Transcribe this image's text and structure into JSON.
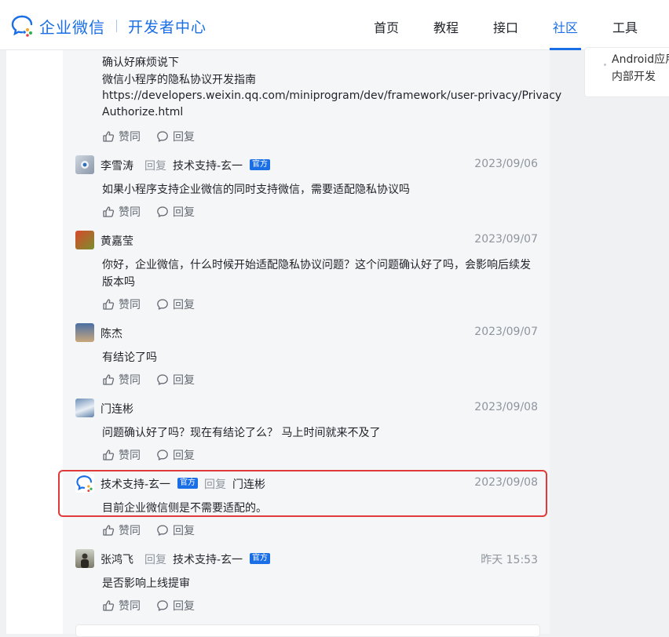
{
  "header": {
    "brand": "企业微信",
    "subtitle": "开发者中心",
    "nav": [
      "首页",
      "教程",
      "接口",
      "社区",
      "工具"
    ],
    "active_nav": "社区"
  },
  "sidebar_right": {
    "lines": [
      "Android应用",
      "内部开发"
    ]
  },
  "top_post": {
    "lines": [
      "确认好麻烦说下",
      "微信小程序的隐私协议开发指南",
      "https://developers.weixin.qq.com/miniprogram/dev/framework/user-privacy/Privacy",
      "Authorize.html"
    ]
  },
  "actions": {
    "like": "赞同",
    "reply": "回复"
  },
  "reply_word": "回复",
  "official_badge": "官方",
  "comments": [
    {
      "author": "李雪涛",
      "reply_to": "技术支持-玄一",
      "date": "2023/09/06",
      "text": [
        "如果小程序支持企业微信的同时支持微信，需要适配隐私协议吗"
      ]
    },
    {
      "author": "黄嘉莹",
      "date": "2023/09/07",
      "text": [
        "你好，企业微信，什么时候开始适配隐私协议问题？这个问题确认好了吗，会影响后续发",
        "版本吗"
      ]
    },
    {
      "author": "陈杰",
      "date": "2023/09/07",
      "text": [
        "有结论了吗"
      ]
    },
    {
      "author": "门连彬",
      "date": "2023/09/08",
      "text": [
        "问题确认好了吗？现在有结论了么？  马上时间就来不及了"
      ]
    },
    {
      "author": "技术支持-玄一",
      "reply_to": "门连彬",
      "date": "2023/09/08",
      "text": [
        "目前企业微信侧是不需要适配的。"
      ]
    },
    {
      "author": "张鸿飞",
      "reply_to": "技术支持-玄一",
      "date": "昨天 15:53",
      "text": [
        "是否影响上线提审"
      ]
    }
  ],
  "colors": {
    "accent": "#1a6ee6",
    "highlight": "#e03a3a"
  }
}
